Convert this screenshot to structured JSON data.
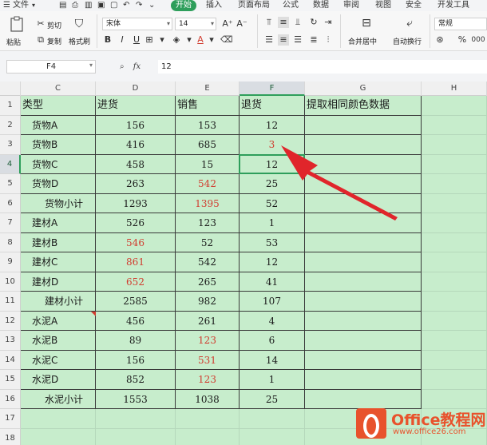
{
  "menu": {
    "file": "文件",
    "tabs": [
      "开始",
      "插入",
      "页面布局",
      "公式",
      "数据",
      "审阅",
      "视图",
      "安全",
      "开发工具"
    ]
  },
  "ribbon": {
    "paste": "粘贴",
    "cut": "剪切",
    "copy": "复制",
    "format_painter": "格式刷",
    "font_name": "宋体",
    "font_size": "14",
    "merge_center": "合并居中",
    "wrap_text": "自动换行",
    "number_format": "常规",
    "percent": "%",
    "thousands": "000"
  },
  "formula_bar": {
    "name_box": "F4",
    "fx": "fx",
    "value": "12"
  },
  "columns": [
    "C",
    "D",
    "E",
    "F",
    "G",
    "H"
  ],
  "rows": [
    "1",
    "2",
    "3",
    "4",
    "5",
    "6",
    "7",
    "8",
    "9",
    "10",
    "11",
    "12",
    "13",
    "14",
    "15",
    "16",
    "17",
    "18"
  ],
  "sheet": {
    "headers": [
      "类型",
      "进货",
      "销售",
      "退货",
      "提取相同颜色数据"
    ],
    "data": [
      {
        "name": "货物A",
        "indent": 1,
        "in": "156",
        "sale": "153",
        "ret": "12",
        "red": []
      },
      {
        "name": "货物B",
        "indent": 1,
        "in": "416",
        "sale": "685",
        "ret": "3",
        "red": [
          "ret"
        ]
      },
      {
        "name": "货物C",
        "indent": 1,
        "in": "458",
        "sale": "15",
        "ret": "12",
        "red": []
      },
      {
        "name": "货物D",
        "indent": 1,
        "in": "263",
        "sale": "542",
        "ret": "25",
        "red": [
          "sale"
        ]
      },
      {
        "name": "货物小计",
        "indent": 2,
        "in": "1293",
        "sale": "1395",
        "ret": "52",
        "red": [
          "sale"
        ]
      },
      {
        "name": "建材A",
        "indent": 1,
        "in": "526",
        "sale": "123",
        "ret": "1",
        "red": []
      },
      {
        "name": "建材B",
        "indent": 1,
        "in": "546",
        "sale": "52",
        "ret": "53",
        "red": [
          "in"
        ]
      },
      {
        "name": "建材C",
        "indent": 1,
        "in": "861",
        "sale": "542",
        "ret": "12",
        "red": [
          "in"
        ]
      },
      {
        "name": "建材D",
        "indent": 1,
        "in": "652",
        "sale": "265",
        "ret": "41",
        "red": [
          "in"
        ]
      },
      {
        "name": "建材小计",
        "indent": 2,
        "in": "2585",
        "sale": "982",
        "ret": "107",
        "red": []
      },
      {
        "name": "水泥A",
        "indent": 1,
        "in": "456",
        "sale": "261",
        "ret": "4",
        "red": []
      },
      {
        "name": "水泥B",
        "indent": 1,
        "in": "89",
        "sale": "123",
        "ret": "6",
        "red": [
          "sale"
        ]
      },
      {
        "name": "水泥C",
        "indent": 1,
        "in": "156",
        "sale": "531",
        "ret": "14",
        "red": [
          "sale"
        ]
      },
      {
        "name": "水泥D",
        "indent": 1,
        "in": "852",
        "sale": "123",
        "ret": "1",
        "red": [
          "sale"
        ]
      },
      {
        "name": "水泥小计",
        "indent": 2,
        "in": "1553",
        "sale": "1038",
        "ret": "25",
        "red": []
      }
    ],
    "active_cell": "F4"
  },
  "colors": {
    "accent": "#2e9e5b",
    "sheet_bg": "#c7edcc",
    "red_text": "#d13c2f",
    "arrow": "#e0252b"
  },
  "watermark": {
    "title": "Office教程网",
    "url": "www.office26.com"
  }
}
